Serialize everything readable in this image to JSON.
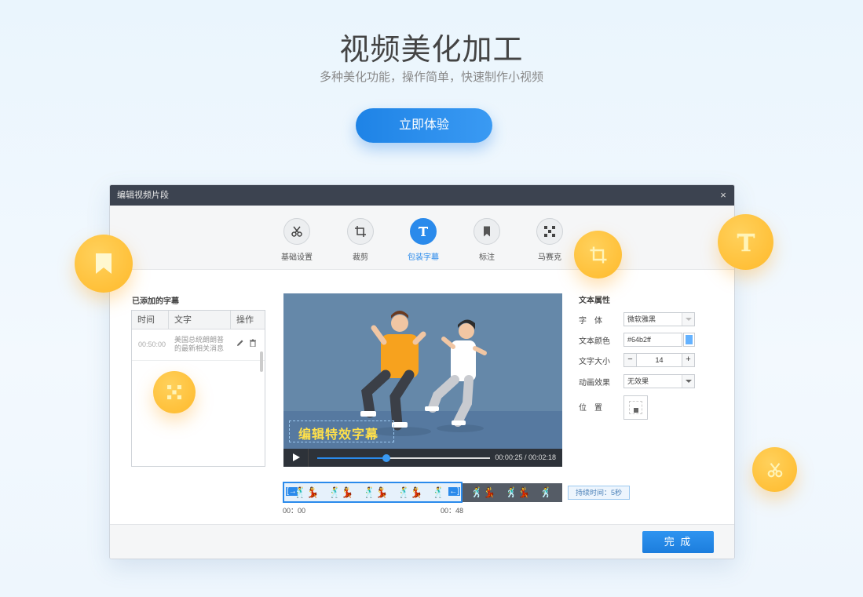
{
  "hero": {
    "title": "视频美化加工",
    "subtitle": "多种美化功能，操作简单，快速制作小视频",
    "cta_label": "立即体验"
  },
  "window": {
    "title": "编辑视频片段",
    "close_glyph": "×"
  },
  "toolbar": {
    "items": [
      {
        "label": "基础设置",
        "icon": "scissors-icon"
      },
      {
        "label": "裁剪",
        "icon": "crop-icon"
      },
      {
        "label": "包装字幕",
        "icon": "text-icon"
      },
      {
        "label": "标注",
        "icon": "bookmark-icon"
      },
      {
        "label": "马赛克",
        "icon": "mosaic-icon"
      }
    ],
    "active_index": 2
  },
  "subtitles": {
    "section_title": "已添加的字幕",
    "columns": [
      "时间",
      "文字",
      "操作"
    ],
    "rows": [
      {
        "time": "00:50:00",
        "text": "美国总统朗朗普的最新相关消息"
      }
    ]
  },
  "preview": {
    "caption_text": "编辑特效字幕",
    "time_display": "00:00:25 / 00:02:18",
    "progress_fraction": 0.4
  },
  "timeline": {
    "start_label": "00：00",
    "end_label": "00：48",
    "duration_tag": "持续时间：5秒"
  },
  "properties": {
    "section_title": "文本属性",
    "font_label": "字　体",
    "font_value": "微软雅黑",
    "color_label": "文本颜色",
    "color_value": "#64b2ff",
    "size_label": "文字大小",
    "size_value": "14",
    "size_minus": "−",
    "size_plus": "+",
    "animation_label": "动画效果",
    "animation_value": "无效果",
    "position_label": "位　置"
  },
  "footer": {
    "done_label": "完 成"
  },
  "colors": {
    "accent": "#2a8aeb",
    "bubble": "#ffc13b",
    "caption": "#ffe04a",
    "swatch": "#64b2ff"
  }
}
